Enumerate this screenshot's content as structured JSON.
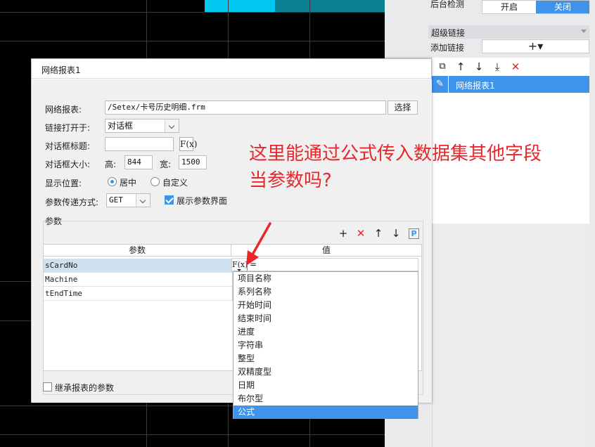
{
  "right_panel": {
    "backend_check_label": "后台检测",
    "toggle_on": "开启",
    "toggle_off": "关闭",
    "hyperlink_section": "超级链接",
    "add_link_label": "添加链接",
    "add_link_button": "+▾",
    "link_items": [
      "网络报表1"
    ]
  },
  "dialog": {
    "title": "网络报表1",
    "report_label": "网络报表:",
    "report_path": "/Setex/卡号历史明细.frm",
    "choose_button": "选择",
    "open_in_label": "链接打开于:",
    "open_in_value": "对话框",
    "dialog_title_label": "对话框标题:",
    "fx_label": "F(x)",
    "dialog_size_label": "对话框大小:",
    "height_label": "高:",
    "height_value": "844",
    "width_label": "宽:",
    "width_value": "1500",
    "position_label": "显示位置:",
    "position_center": "居中",
    "position_custom": "自定义",
    "param_method_label": "参数传递方式:",
    "param_method_value": "GET",
    "show_param_ui_label": "展示参数界面",
    "params_section": "参数",
    "table_headers": [
      "参数",
      "值"
    ],
    "params": [
      "sCardNo",
      "Machine",
      "tEndTime"
    ],
    "fx_cell_prefix": "F(x)",
    "fx_cell_value": "=",
    "inherit_params_label": "继承报表的参数"
  },
  "dropdown": {
    "items": [
      "项目名称",
      "系列名称",
      "开始时间",
      "结束时间",
      "进度",
      "字符串",
      "整型",
      "双精度型",
      "日期",
      "布尔型",
      "公式"
    ],
    "selected": "公式"
  },
  "annotation": {
    "line1": "这里能通过公式传入数据集其他字段",
    "line2": "当参数吗?"
  },
  "colors": {
    "accent": "#3f94e9",
    "annotation": "#e8262b",
    "cyan_bar": "#00c8f0",
    "teal_bar": "#0a7f93"
  }
}
